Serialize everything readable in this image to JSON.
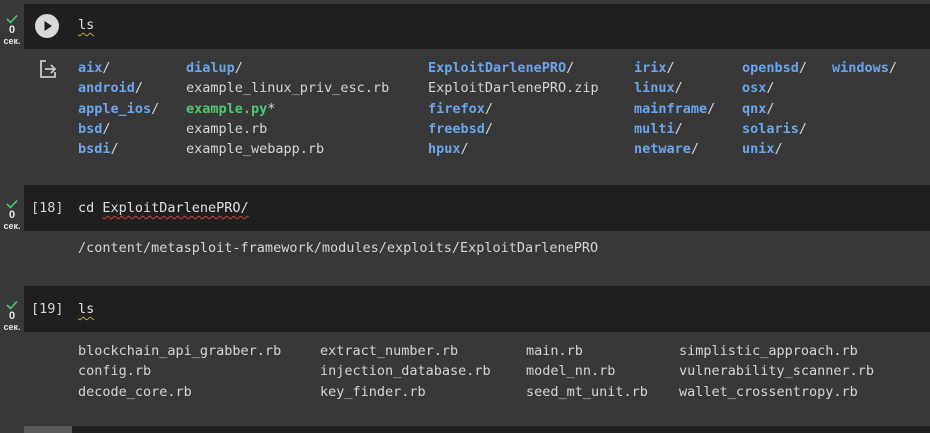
{
  "cells": [
    {
      "status": {
        "count": "0",
        "unit": "сек."
      },
      "command": "ls",
      "execution_count": "",
      "output_columns": [
        [
          {
            "text": "aix",
            "slash": "/",
            "kind": "dir"
          },
          {
            "text": "android",
            "slash": "/",
            "kind": "dir"
          },
          {
            "text": "apple_ios",
            "slash": "/",
            "kind": "dir"
          },
          {
            "text": "bsd",
            "slash": "/",
            "kind": "dir"
          },
          {
            "text": "bsdi",
            "slash": "/",
            "kind": "dir"
          }
        ],
        [
          {
            "text": "dialup",
            "slash": "/",
            "kind": "dir"
          },
          {
            "text": "example_linux_priv_esc.rb",
            "slash": "",
            "kind": "file"
          },
          {
            "text": "example.py",
            "slash": "*",
            "kind": "exe"
          },
          {
            "text": "example.rb",
            "slash": "",
            "kind": "file"
          },
          {
            "text": "example_webapp.rb",
            "slash": "",
            "kind": "file"
          }
        ],
        [
          {
            "text": "ExploitDarlenePRO",
            "slash": "/",
            "kind": "dir"
          },
          {
            "text": "ExploitDarlenePRO.zip",
            "slash": "",
            "kind": "file"
          },
          {
            "text": "firefox",
            "slash": "/",
            "kind": "dir"
          },
          {
            "text": "freebsd",
            "slash": "/",
            "kind": "dir"
          },
          {
            "text": "hpux",
            "slash": "/",
            "kind": "dir"
          }
        ],
        [
          {
            "text": "irix",
            "slash": "/",
            "kind": "dir"
          },
          {
            "text": "linux",
            "slash": "/",
            "kind": "dir"
          },
          {
            "text": "mainframe",
            "slash": "/",
            "kind": "dir"
          },
          {
            "text": "multi",
            "slash": "/",
            "kind": "dir"
          },
          {
            "text": "netware",
            "slash": "/",
            "kind": "dir"
          }
        ],
        [
          {
            "text": "openbsd",
            "slash": "/",
            "kind": "dir"
          },
          {
            "text": "osx",
            "slash": "/",
            "kind": "dir"
          },
          {
            "text": "qnx",
            "slash": "/",
            "kind": "dir"
          },
          {
            "text": "solaris",
            "slash": "/",
            "kind": "dir"
          },
          {
            "text": "unix",
            "slash": "/",
            "kind": "dir"
          }
        ],
        [
          {
            "text": "windows",
            "slash": "/",
            "kind": "dir"
          }
        ]
      ]
    },
    {
      "status": {
        "count": "0",
        "unit": "сек."
      },
      "execution_count": "[18]",
      "command_prefix": "cd ",
      "command_arg": "ExploitDarlenePRO/",
      "output_text": "/content/metasploit-framework/modules/exploits/ExploitDarlenePRO"
    },
    {
      "status": {
        "count": "0",
        "unit": "сек."
      },
      "execution_count": "[19]",
      "command": "ls",
      "output_columns": [
        [
          "blockchain_api_grabber.rb",
          "config.rb",
          "decode_core.rb"
        ],
        [
          "extract_number.rb",
          "injection_database.rb",
          "key_finder.rb"
        ],
        [
          "main.rb",
          "model_nn.rb",
          "seed_mt_unit.rb"
        ],
        [
          "simplistic_approach.rb",
          "vulnerability_scanner.rb",
          "wallet_crossentropy.rb"
        ]
      ]
    }
  ],
  "icons": {
    "status": "check-icon",
    "run": "play-icon",
    "output": "output-exit-icon"
  },
  "colors": {
    "directory": "#6aa6ee",
    "executable": "#4ec973",
    "check": "#4ec973"
  }
}
